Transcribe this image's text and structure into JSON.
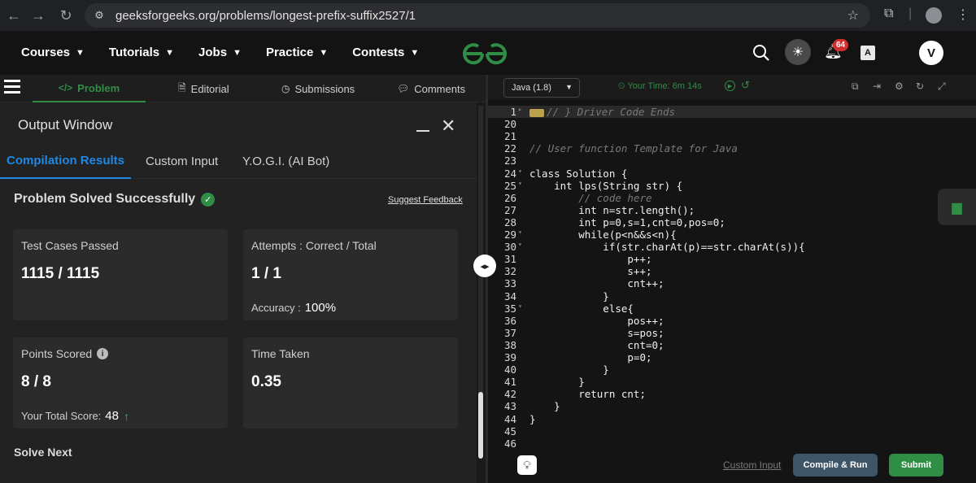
{
  "browser": {
    "url": "geeksforgeeks.org/problems/longest-prefix-suffix2527/1"
  },
  "nav": {
    "items": [
      "Courses",
      "Tutorials",
      "Jobs",
      "Practice",
      "Contests"
    ],
    "logo": "GG",
    "notifications": "64",
    "avatar": "V"
  },
  "problem_tabs": {
    "problem": "Problem",
    "editorial": "Editorial",
    "submissions": "Submissions",
    "comments": "Comments"
  },
  "output": {
    "title": "Output Window",
    "tabs": [
      "Compilation Results",
      "Custom Input",
      "Y.O.G.I. (AI Bot)"
    ],
    "status": "Problem Solved Successfully",
    "feedback": "Suggest Feedback",
    "test_cases_label": "Test Cases Passed",
    "test_cases_value": "1115 / 1115",
    "attempts_label": "Attempts : Correct / Total",
    "attempts_value": "1 / 1",
    "accuracy_label": "Accuracy :",
    "accuracy_value": "100%",
    "points_label": "Points Scored",
    "points_value": "8 / 8",
    "total_score_label": "Your Total Score:",
    "total_score_value": "48",
    "time_label": "Time Taken",
    "time_value": "0.35",
    "solve_next": "Solve Next"
  },
  "editor": {
    "language": "Java (1.8)",
    "timer": "Your Time: 6m 14s",
    "lines": [
      {
        "n": "1",
        "text": "// } Driver Code Ends",
        "type": "comment",
        "fold": "▸",
        "folded": true
      },
      {
        "n": "20",
        "text": "",
        "type": "code"
      },
      {
        "n": "21",
        "text": "",
        "type": "code"
      },
      {
        "n": "22",
        "text": "// User function Template for Java",
        "type": "comment"
      },
      {
        "n": "23",
        "text": "",
        "type": "code"
      },
      {
        "n": "24",
        "text": "class Solution {",
        "type": "code",
        "fold": "▾"
      },
      {
        "n": "25",
        "text": "    int lps(String str) {",
        "type": "code",
        "fold": "▾"
      },
      {
        "n": "26",
        "text": "        // code here",
        "type": "comment"
      },
      {
        "n": "27",
        "text": "        int n=str.length();",
        "type": "code"
      },
      {
        "n": "28",
        "text": "        int p=0,s=1,cnt=0,pos=0;",
        "type": "code"
      },
      {
        "n": "29",
        "text": "        while(p<n&&s<n){",
        "type": "code",
        "fold": "▾"
      },
      {
        "n": "30",
        "text": "            if(str.charAt(p)==str.charAt(s)){",
        "type": "code",
        "fold": "▾"
      },
      {
        "n": "31",
        "text": "                p++;",
        "type": "code"
      },
      {
        "n": "32",
        "text": "                s++;",
        "type": "code"
      },
      {
        "n": "33",
        "text": "                cnt++;",
        "type": "code"
      },
      {
        "n": "34",
        "text": "            }",
        "type": "code"
      },
      {
        "n": "35",
        "text": "            else{",
        "type": "code",
        "fold": "▾"
      },
      {
        "n": "36",
        "text": "                pos++;",
        "type": "code"
      },
      {
        "n": "37",
        "text": "                s=pos;",
        "type": "code"
      },
      {
        "n": "38",
        "text": "                cnt=0;",
        "type": "code"
      },
      {
        "n": "39",
        "text": "                p=0;",
        "type": "code"
      },
      {
        "n": "40",
        "text": "            }",
        "type": "code"
      },
      {
        "n": "41",
        "text": "        }",
        "type": "code"
      },
      {
        "n": "42",
        "text": "        return cnt;",
        "type": "code"
      },
      {
        "n": "43",
        "text": "    }",
        "type": "code"
      },
      {
        "n": "44",
        "text": "}",
        "type": "code"
      },
      {
        "n": "45",
        "text": "",
        "type": "code"
      },
      {
        "n": "46",
        "text": "",
        "type": "code"
      }
    ]
  },
  "footer": {
    "custom_input": "Custom Input",
    "compile_run": "Compile & Run",
    "submit": "Submit"
  },
  "colors": {
    "accent_green": "#2f8d46",
    "accent_blue": "#1e88e5",
    "badge_red": "#d32f2f"
  }
}
